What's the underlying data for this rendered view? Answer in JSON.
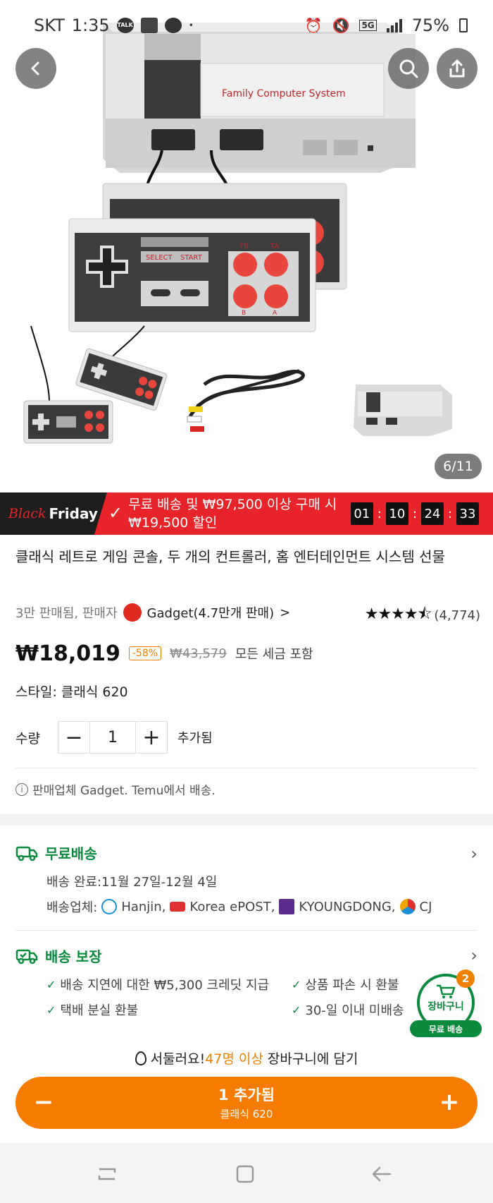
{
  "status_bar": {
    "carrier": "SKT",
    "time": "1:35",
    "talk_badge": "TALK",
    "network": "5G",
    "battery": "75%"
  },
  "gallery": {
    "counter": "6/11",
    "product_label": "Family Computer System",
    "controller_labels": {
      "select": "SELECT",
      "start": "START",
      "tb": "TB",
      "ta": "TA",
      "b": "B",
      "a": "A"
    }
  },
  "promo": {
    "black": "Black",
    "friday": "Friday",
    "line1": "무료 배송 및 ₩97,500 이상 구매 시",
    "line2": "₩19,500 할인",
    "timer": [
      "01",
      "10",
      "24",
      "33"
    ]
  },
  "product": {
    "title": "클래식 레트로 게임 콘솔, 두 개의 컨트롤러, 홈 엔터테인먼트 시스템 선물",
    "sold_info": "3만 판매됨, 판매자",
    "seller": "Gadget(4.7만개 판매)",
    "stars": "★★★★⯪",
    "rating_count": "(4,774)",
    "rating_value": 4.5,
    "price": "₩18,019",
    "discount": "-58%",
    "original_price": "₩43,579",
    "tax_note": "모든 세금 포함",
    "style": "스타일: 클래식 620",
    "qty_label": "수량",
    "qty_value": "1",
    "added_label": "추가됨",
    "seller_note": "판매업체 Gadget. Temu에서 배송."
  },
  "shipping": {
    "title": "무료배송",
    "delivery": "배송 완료:11월 27일-12월 4일",
    "carriers_label": "배송업체:",
    "carriers": [
      "Hanjin,",
      "Korea ePOST,",
      "KYOUNGDONG,",
      "CJ"
    ]
  },
  "guarantee": {
    "title": "배송 보장",
    "items": [
      "배송 지연에 대한 ₩5,300 크레딧 지급",
      "상품 파손 시 환불",
      "택배 분실 환불",
      "30-일 이내 미배송"
    ]
  },
  "cart": {
    "label": "장바구니",
    "count": "2",
    "free_ship": "무료 배송"
  },
  "hurry": {
    "prefix": "서둘러요!",
    "highlight": "47명 이상",
    "suffix": " 장바구니에 담기"
  },
  "cta": {
    "main": "1 추가됨",
    "sub": "클래식 620"
  },
  "colors": {
    "accent_orange": "#f57c00",
    "green": "#0a8a3d",
    "promo_red": "#e8232a"
  }
}
